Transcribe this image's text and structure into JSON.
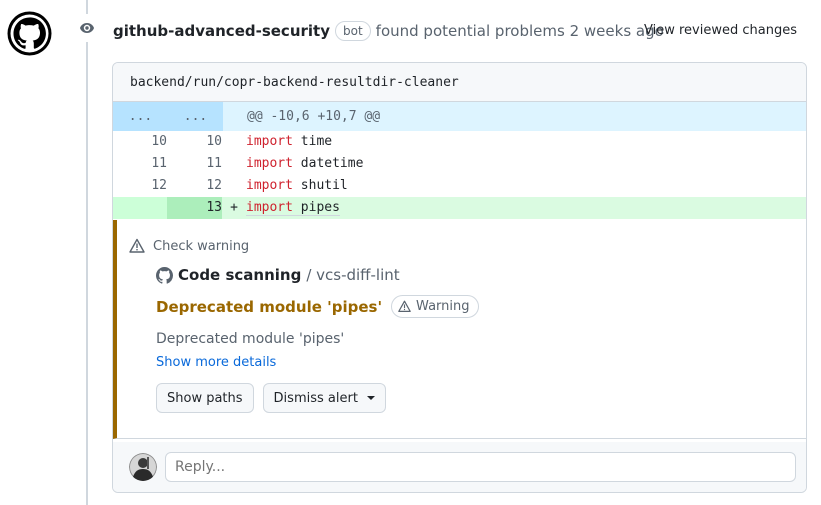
{
  "header": {
    "author": "github-advanced-security",
    "badge": "bot",
    "action": "found potential problems",
    "time": "2 weeks ago",
    "view_changes": "View reviewed changes"
  },
  "file": {
    "path": "backend/run/copr-backend-resultdir-cleaner"
  },
  "diff": {
    "hunk": {
      "left": "...",
      "right": "...",
      "header": "@@ -10,6 +10,7 @@"
    },
    "lines": [
      {
        "old": "10",
        "new": "10",
        "marker": "",
        "keyword": "import",
        "rest": " time"
      },
      {
        "old": "11",
        "new": "11",
        "marker": "",
        "keyword": "import",
        "rest": " datetime"
      },
      {
        "old": "12",
        "new": "12",
        "marker": "",
        "keyword": "import",
        "rest": " shutil"
      },
      {
        "old": "",
        "new": "13",
        "marker": "+",
        "keyword": "import",
        "rest": " pipes"
      }
    ]
  },
  "alert": {
    "check": "Check warning",
    "tool": "Code scanning",
    "rule": "/ vcs-diff-lint",
    "title": "Deprecated module 'pipes'",
    "severity": "Warning",
    "description": "Deprecated module 'pipes'",
    "more": "Show more details",
    "show_paths": "Show paths",
    "dismiss": "Dismiss alert"
  },
  "reply": {
    "placeholder": "Reply..."
  },
  "colors": {
    "warning": "#9a6700",
    "add_bg": "#dafbe1",
    "hunk_bg": "#ddf4ff",
    "link": "#0969da"
  }
}
